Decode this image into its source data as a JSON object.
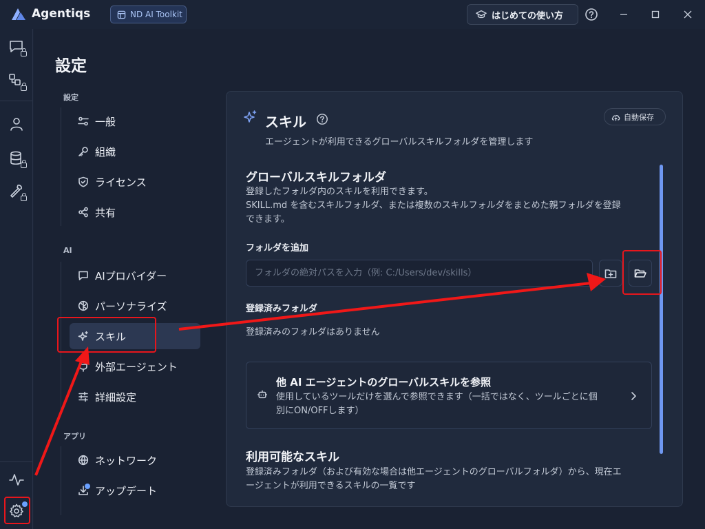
{
  "titlebar": {
    "app_name": "Agentiqs",
    "badge_label": "ND AI Toolkit",
    "guide_button": "はじめての使い方"
  },
  "activity_bar": {
    "items": [
      "chat-icon",
      "workflow-icon",
      "user-icon",
      "database-icon",
      "tools-icon",
      "activity-icon",
      "gear-icon"
    ]
  },
  "page": {
    "title": "設定"
  },
  "nav": {
    "groups": [
      {
        "label": "設定",
        "items": [
          "一般",
          "組織",
          "ライセンス",
          "共有"
        ]
      },
      {
        "label": "AI",
        "items": [
          "AIプロバイダー",
          "パーソナライズ",
          "スキル",
          "外部エージェント",
          "詳細設定"
        ]
      },
      {
        "label": "アプリ",
        "items": [
          "ネットワーク",
          "アップデート"
        ]
      }
    ],
    "active": "スキル"
  },
  "panel": {
    "title": "スキル",
    "description": "エージェントが利用できるグローバルスキルフォルダを管理します",
    "autosave_label": "自動保存",
    "global_folder": {
      "title": "グローバルスキルフォルダ",
      "line1": "登録したフォルダ内のスキルを利用できます。",
      "line2": "SKILL.md を含むスキルフォルダ、または複数のスキルフォルダをまとめた親フォルダを登録",
      "line3": "できます。"
    },
    "add_folder": {
      "label": "フォルダを追加",
      "placeholder": "フォルダの絶対パスを入力（例: C:/Users/dev/skills）",
      "value": ""
    },
    "registered": {
      "label": "登録済みフォルダ",
      "empty_text": "登録済みのフォルダはありません"
    },
    "reference_card": {
      "title": "他 AI エージェントのグローバルスキルを参照",
      "line1": "使用しているツールだけを選んで参照できます（一括ではなく、ツールごとに個",
      "line2": "別にON/OFFします）"
    },
    "available": {
      "title": "利用可能なスキル",
      "line1": "登録済みフォルダ（および有効な場合は他エージェントのグローバルフォルダ）から、現在エ",
      "line2": "ージェントが利用できるスキルの一覧です"
    }
  },
  "colors": {
    "background": "#1b2436",
    "panel": "#202a3d",
    "accent": "#6f97f0",
    "annotation": "#e8161c"
  }
}
